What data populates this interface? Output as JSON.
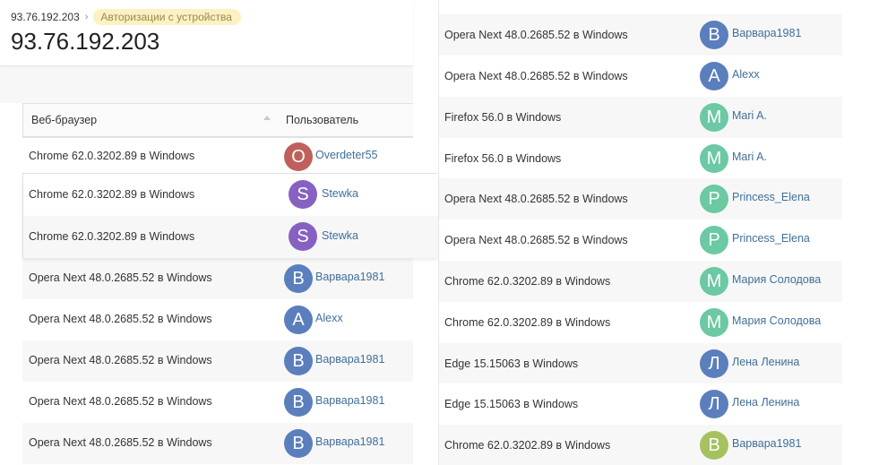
{
  "breadcrumb": {
    "ip": "93.76.192.203",
    "current": "Авторизации с устройства"
  },
  "page_title": "93.76.192.203",
  "table": {
    "col_browser": "Веб-браузер",
    "col_user": "Пользователь"
  },
  "colors": {
    "link": "#3f6f9a",
    "badge_bg": "#fbf1c2",
    "stripe": "#f7f7f7"
  },
  "left_rows": [
    {
      "browser": "Chrome 62.0.3202.89 в Windows",
      "initial": "O",
      "user": "Overdeter55",
      "color": "#c0605c"
    },
    {
      "browser": "Opera Next 48.0.2685.52 в Windows",
      "initial": "B",
      "user": "Варвара1981",
      "color": "#5b7fbd"
    },
    {
      "browser": "Opera Next 48.0.2685.52 в Windows",
      "initial": "A",
      "user": "Alexx",
      "color": "#5b7fbd"
    },
    {
      "browser": "Opera Next 48.0.2685.52 в Windows",
      "initial": "B",
      "user": "Варвара1981",
      "color": "#5b7fbd"
    },
    {
      "browser": "Opera Next 48.0.2685.52 в Windows",
      "initial": "B",
      "user": "Варвара1981",
      "color": "#5b7fbd"
    },
    {
      "browser": "Opera Next 48.0.2685.52 в Windows",
      "initial": "B",
      "user": "Варвара1981",
      "color": "#5b7fbd"
    }
  ],
  "popup_rows": [
    {
      "browser": "Chrome 62.0.3202.89 в Windows",
      "initial": "S",
      "user": "Stewka",
      "color": "#8661c1"
    },
    {
      "browser": "Chrome 62.0.3202.89 в Windows",
      "initial": "S",
      "user": "Stewka",
      "color": "#8661c1"
    }
  ],
  "right_rows": [
    {
      "browser": "Opera Next 48.0.2685.52 в Windows",
      "initial": "B",
      "user": "Варвара1981",
      "color": "#5b7fbd"
    },
    {
      "browser": "Opera Next 48.0.2685.52 в Windows",
      "initial": "A",
      "user": "Alexx",
      "color": "#5b7fbd"
    },
    {
      "browser": "Firefox 56.0 в Windows",
      "initial": "M",
      "user": "Mari A.",
      "color": "#6bc9a3"
    },
    {
      "browser": "Firefox 56.0 в Windows",
      "initial": "M",
      "user": "Mari A.",
      "color": "#6bc9a3"
    },
    {
      "browser": "Opera Next 48.0.2685.52 в Windows",
      "initial": "P",
      "user": "Princess_Elena",
      "color": "#6bc9a3"
    },
    {
      "browser": "Opera Next 48.0.2685.52 в Windows",
      "initial": "P",
      "user": "Princess_Elena",
      "color": "#6bc9a3"
    },
    {
      "browser": "Chrome 62.0.3202.89 в Windows",
      "initial": "M",
      "user": "Мария Солодова",
      "color": "#6bc9a3"
    },
    {
      "browser": "Chrome 62.0.3202.89 в Windows",
      "initial": "M",
      "user": "Мария Солодова",
      "color": "#6bc9a3"
    },
    {
      "browser": "Edge 15.15063 в Windows",
      "initial": "Л",
      "user": "Лена Ленина",
      "color": "#5b7fbd"
    },
    {
      "browser": "Edge 15.15063 в Windows",
      "initial": "Л",
      "user": "Лена Ленина",
      "color": "#5b7fbd"
    },
    {
      "browser": "Chrome 62.0.3202.89 в Windows",
      "initial": "B",
      "user": "Варвара1981",
      "color": "#a5c25f"
    }
  ]
}
